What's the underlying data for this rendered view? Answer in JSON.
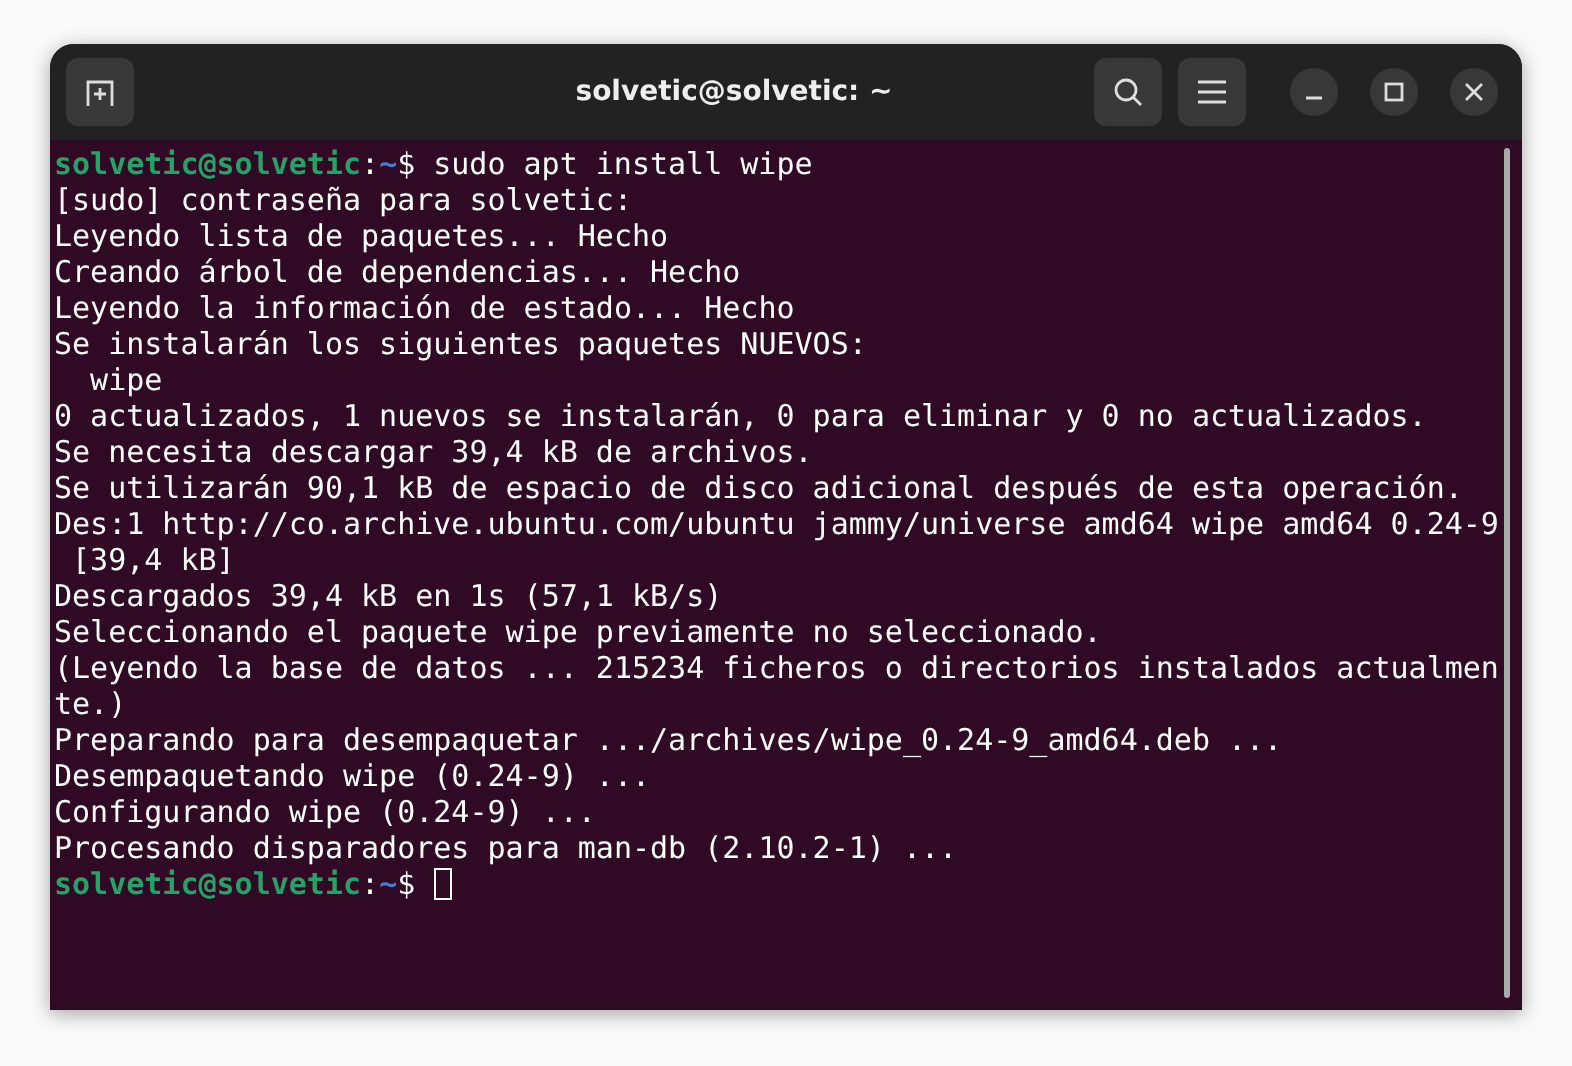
{
  "window": {
    "title": "solvetic@solvetic: ~"
  },
  "lines": [
    {
      "kind": "prompt",
      "user": "solvetic@solvetic",
      "separator": ":",
      "path": "~",
      "symbol": "$",
      "command": "sudo apt install wipe",
      "cursor": false
    },
    {
      "kind": "output",
      "text": "[sudo] contraseña para solvetic:"
    },
    {
      "kind": "output",
      "text": "Leyendo lista de paquetes... Hecho"
    },
    {
      "kind": "output",
      "text": "Creando árbol de dependencias... Hecho"
    },
    {
      "kind": "output",
      "text": "Leyendo la información de estado... Hecho"
    },
    {
      "kind": "output",
      "text": "Se instalarán los siguientes paquetes NUEVOS:"
    },
    {
      "kind": "output",
      "text": "  wipe"
    },
    {
      "kind": "output",
      "text": "0 actualizados, 1 nuevos se instalarán, 0 para eliminar y 0 no actualizados."
    },
    {
      "kind": "output",
      "text": "Se necesita descargar 39,4 kB de archivos."
    },
    {
      "kind": "output",
      "text": "Se utilizarán 90,1 kB de espacio de disco adicional después de esta operación."
    },
    {
      "kind": "output",
      "text": "Des:1 http://co.archive.ubuntu.com/ubuntu jammy/universe amd64 wipe amd64 0.24-9"
    },
    {
      "kind": "output",
      "text": " [39,4 kB]"
    },
    {
      "kind": "output",
      "text": "Descargados 39,4 kB en 1s (57,1 kB/s)"
    },
    {
      "kind": "output",
      "text": "Seleccionando el paquete wipe previamente no seleccionado."
    },
    {
      "kind": "output",
      "text": "(Leyendo la base de datos ... 215234 ficheros o directorios instalados actualmen"
    },
    {
      "kind": "output",
      "text": "te.)"
    },
    {
      "kind": "output",
      "text": "Preparando para desempaquetar .../archives/wipe_0.24-9_amd64.deb ..."
    },
    {
      "kind": "output",
      "text": "Desempaquetando wipe (0.24-9) ..."
    },
    {
      "kind": "output",
      "text": "Configurando wipe (0.24-9) ..."
    },
    {
      "kind": "output",
      "text": "Procesando disparadores para man-db (2.10.2-1) ..."
    },
    {
      "kind": "prompt",
      "user": "solvetic@solvetic",
      "separator": ":",
      "path": "~",
      "symbol": "$",
      "cursor": true
    }
  ]
}
